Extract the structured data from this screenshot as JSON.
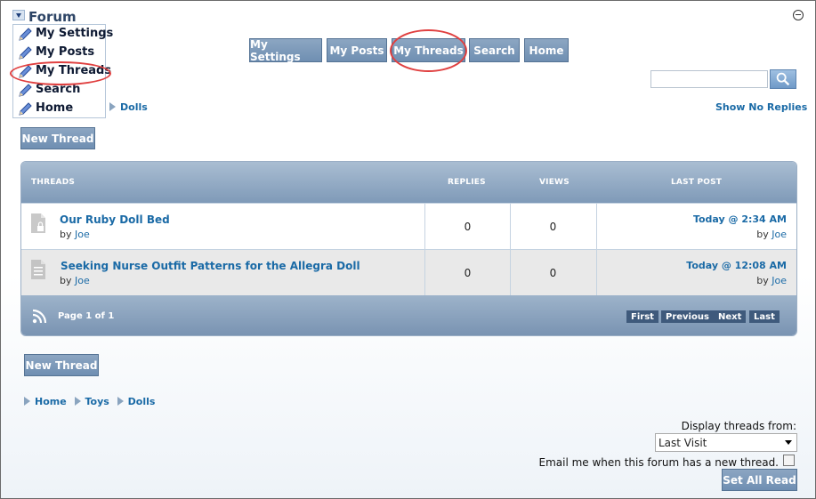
{
  "forum": {
    "title": "Forum",
    "menu": [
      {
        "label": "My Settings"
      },
      {
        "label": "My Posts"
      },
      {
        "label": "My Threads"
      },
      {
        "label": "Search"
      },
      {
        "label": "Home"
      }
    ]
  },
  "nav": {
    "buttons": [
      {
        "label": "My Settings"
      },
      {
        "label": "My Posts"
      },
      {
        "label": "My Threads"
      },
      {
        "label": "Search"
      },
      {
        "label": "Home"
      }
    ]
  },
  "search": {
    "placeholder": ""
  },
  "breadcrumb_top": {
    "current": "Dolls"
  },
  "show_no_replies": "Show No Replies",
  "new_thread_label": "New Thread",
  "threads": {
    "headers": {
      "threads": "THREADS",
      "replies": "REPLIES",
      "views": "VIEWS",
      "last_post": "LAST POST"
    },
    "rows": [
      {
        "title": "Our Ruby Doll Bed",
        "by": "by",
        "author": "Joe",
        "replies": "0",
        "views": "0",
        "last_post_date": "Today @ 2:34 AM",
        "last_post_by": "by",
        "last_post_author": "Joe"
      },
      {
        "title": "Seeking Nurse Outfit Patterns for the Allegra Doll",
        "by": "by",
        "author": "Joe",
        "replies": "0",
        "views": "0",
        "last_post_date": "Today @ 12:08 AM",
        "last_post_by": "by",
        "last_post_author": "Joe"
      }
    ],
    "page_info": "Page 1 of 1",
    "pager": {
      "first": "First",
      "previous": "Previous",
      "next": "Next",
      "last": "Last"
    }
  },
  "breadcrumb_bottom": {
    "items": [
      "Home",
      "Toys",
      "Dolls"
    ]
  },
  "display_threads": {
    "label": "Display threads from:",
    "selected": "Last Visit"
  },
  "email_notify": {
    "label": "Email me when this forum has a new thread."
  },
  "set_all_read": "Set All Read",
  "colors": {
    "accent": "#7f9ab8",
    "link": "#1a6aa6",
    "highlight_circle": "#e04040"
  }
}
